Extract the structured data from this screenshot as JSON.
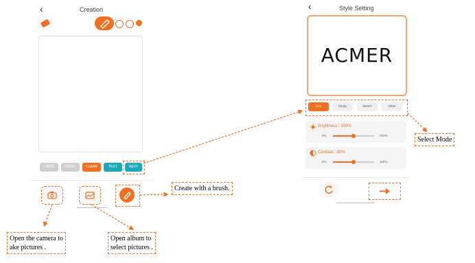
{
  "left_screen": {
    "back_icon": "chevron-left",
    "title": "Creation",
    "tool_icons": [
      "eraser-icon",
      "brush-icon"
    ],
    "action_buttons": [
      "UNDO",
      "REDO",
      "CLEAR",
      "TEXT",
      "NEXT"
    ],
    "bottom_icons": [
      "camera-icon",
      "album-icon",
      "brush-icon"
    ]
  },
  "right_screen": {
    "back_icon": "chevron-left",
    "title": "Style Setting",
    "preview_text": "ACMER",
    "modes": [
      "Line",
      "Shaky",
      "Sketch",
      "Other"
    ],
    "brightness": {
      "label": "Brightness : 100%",
      "min": "0%",
      "max": "200%",
      "level": 0.5
    },
    "contrast": {
      "label": "Contrast : 80%",
      "min": "0%",
      "max": "160%",
      "level": 0.5
    },
    "bottom_icons": [
      "refresh-icon",
      "arrow-right-icon"
    ]
  },
  "annotations": {
    "select_mode": "Select  Mode",
    "create_brush": "Create with a brush.",
    "camera_line1": "Open the camera to",
    "camera_line2": "ake pictures .",
    "album_line1": "Open album to",
    "album_line2": "select pictures ."
  },
  "colors": {
    "accent": "#f26f21",
    "teal": "#1aa9b7",
    "gray": "#cfcfcf"
  }
}
